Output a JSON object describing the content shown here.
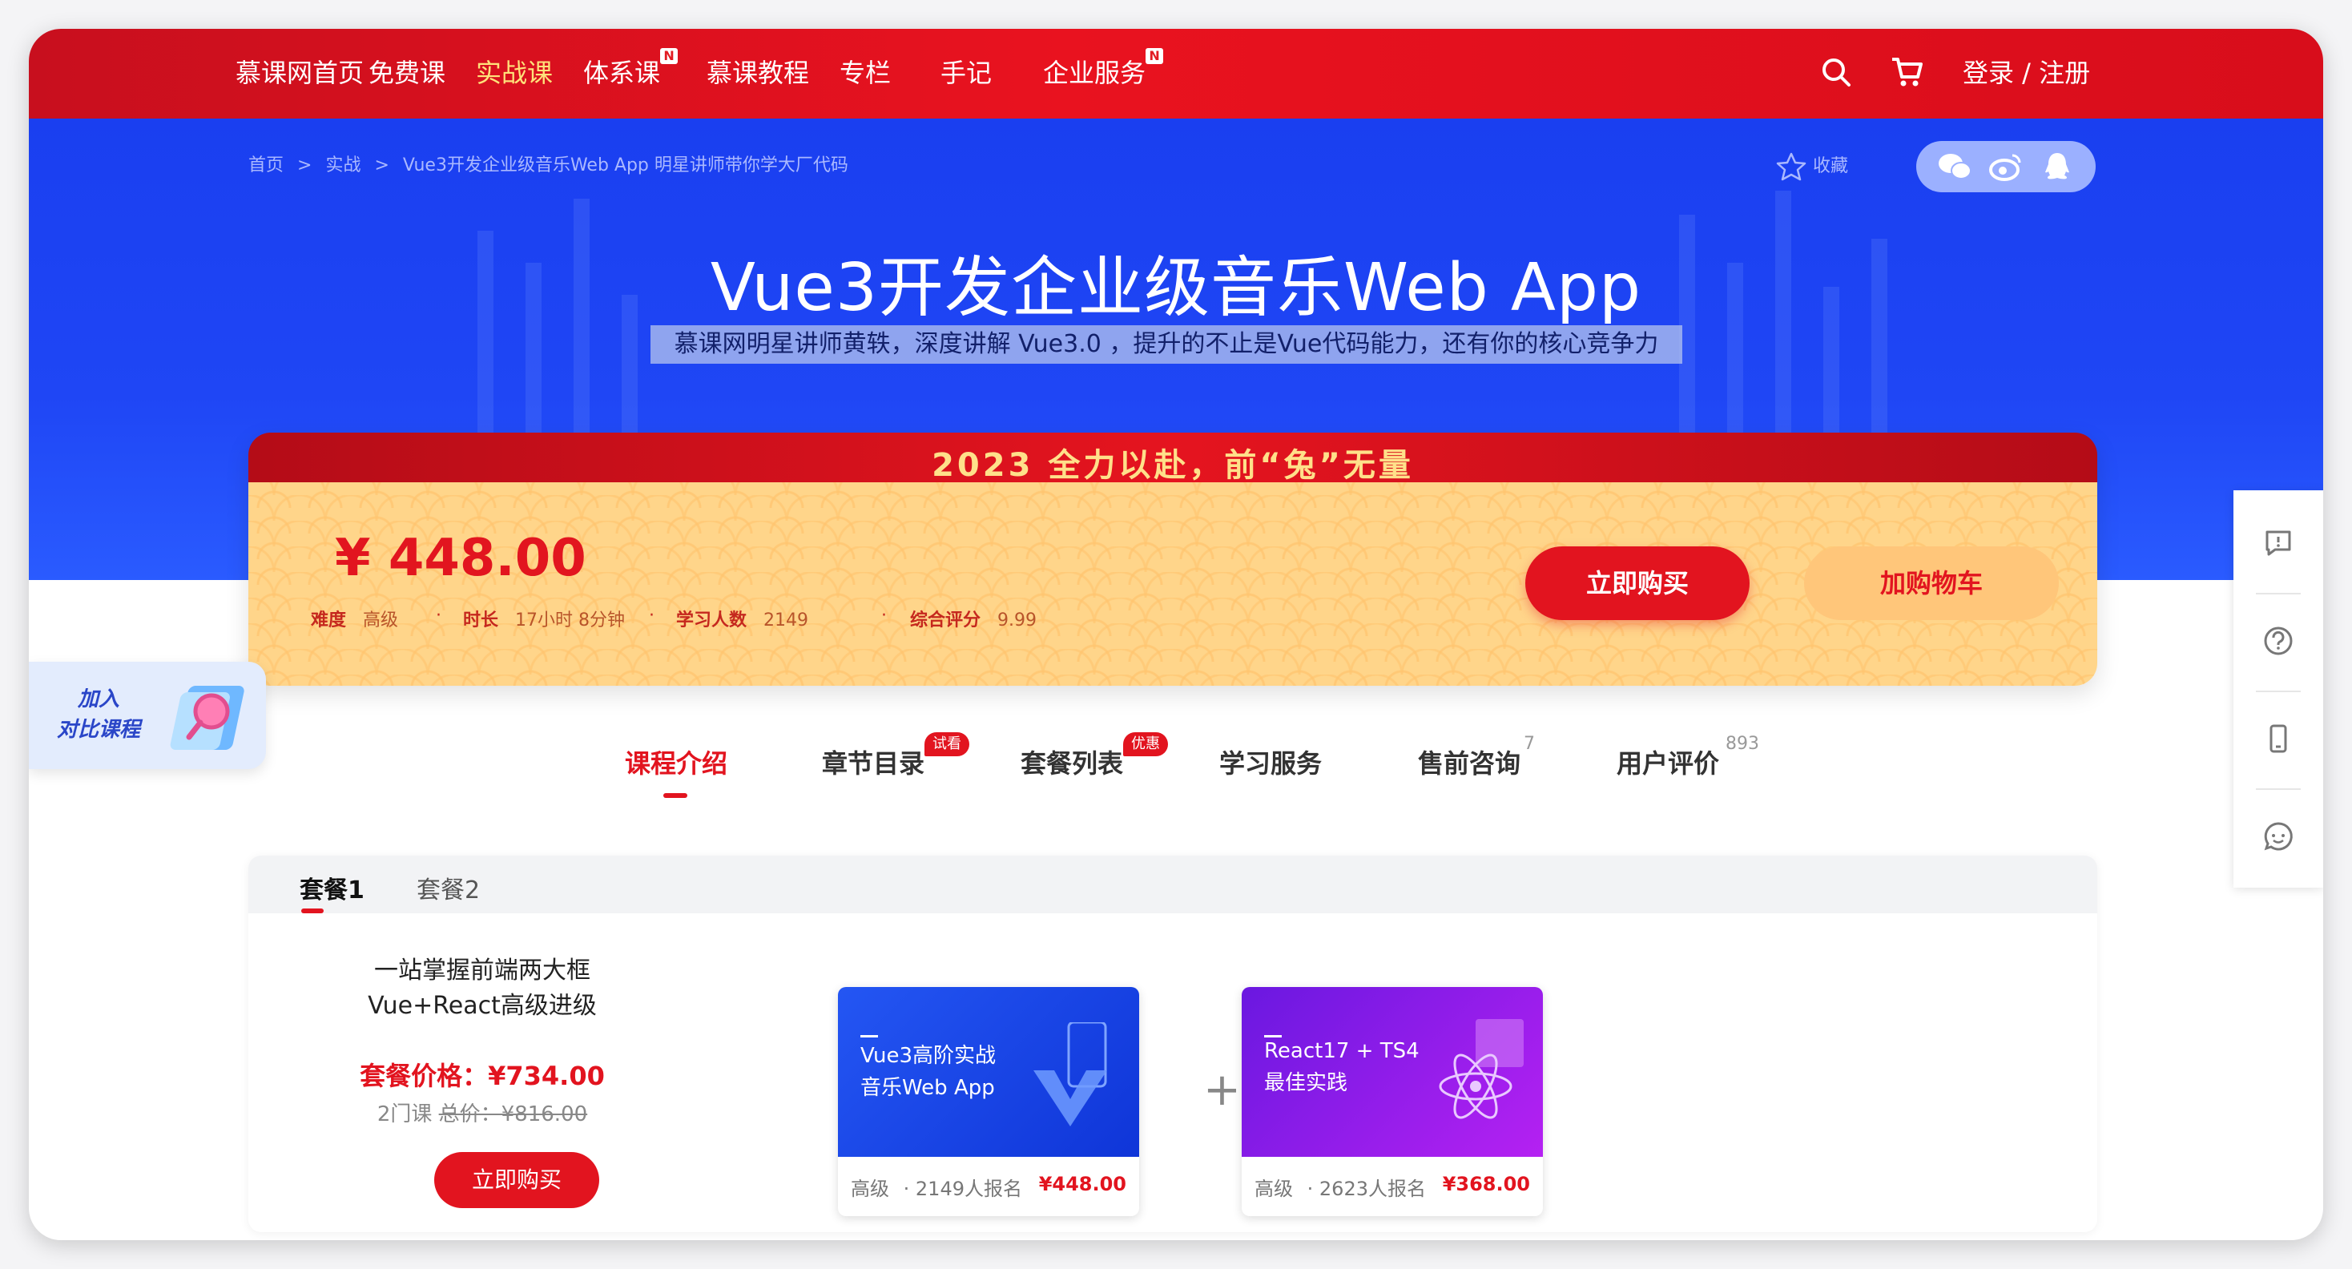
{
  "nav": {
    "items": [
      {
        "label": "慕课网首页",
        "active": false,
        "badge": ""
      },
      {
        "label": "免费课",
        "active": false,
        "badge": ""
      },
      {
        "label": "实战课",
        "active": true,
        "badge": ""
      },
      {
        "label": "体系课",
        "active": false,
        "badge": "N"
      },
      {
        "label": "慕课教程",
        "active": false,
        "badge": ""
      },
      {
        "label": "专栏",
        "active": false,
        "badge": ""
      },
      {
        "label": "手记",
        "active": false,
        "badge": ""
      },
      {
        "label": "企业服务",
        "active": false,
        "badge": "N"
      }
    ],
    "search_icon": "search-icon",
    "cart_icon": "cart-icon",
    "login_label": "登录 / 注册"
  },
  "breadcrumb": {
    "items": [
      "首页",
      "实战",
      "Vue3开发企业级音乐Web App 明星讲师带你学大厂代码"
    ],
    "separator": ">"
  },
  "collect_label": "收藏",
  "share_icons": [
    "wechat-icon",
    "weibo-icon",
    "qq-icon"
  ],
  "hero": {
    "title": "Vue3开发企业级音乐Web App",
    "subtitle": "慕课网明星讲师黄轶，深度讲解 Vue3.0 ，提升的不止是Vue代码能力，还有你的核心竞争力"
  },
  "promo_banner": "2023 全力以赴，前“兔”无量",
  "price": {
    "amount": "¥ 448.00",
    "meta": [
      {
        "key": "难度",
        "value": "高级"
      },
      {
        "key": "时长",
        "value": "17小时 8分钟"
      },
      {
        "key": "学习人数",
        "value": "2149"
      },
      {
        "key": "综合评分",
        "value": "9.99"
      }
    ],
    "buy_label": "立即购买",
    "cart_label": "加购物车"
  },
  "compare_label": "加入\n对比课程",
  "side_tools": [
    "feedback-icon",
    "help-icon",
    "mobile-icon",
    "chat-icon"
  ],
  "tabs": [
    {
      "label": "课程介绍",
      "active": true,
      "badge": "",
      "sup": ""
    },
    {
      "label": "章节目录",
      "active": false,
      "badge": "试看",
      "sup": ""
    },
    {
      "label": "套餐列表",
      "active": false,
      "badge": "优惠",
      "sup": ""
    },
    {
      "label": "学习服务",
      "active": false,
      "badge": "",
      "sup": ""
    },
    {
      "label": "售前咨询",
      "active": false,
      "badge": "",
      "sup": "7"
    },
    {
      "label": "用户评价",
      "active": false,
      "badge": "",
      "sup": "893"
    }
  ],
  "package": {
    "tabs": [
      {
        "label": "套餐1",
        "active": true
      },
      {
        "label": "套餐2",
        "active": false
      }
    ],
    "title": "一站掌握前端两大框 Vue+React高级进级",
    "price_label": "套餐价格：¥734.00",
    "course_count": "2门课",
    "total_label": "总价：¥816.00",
    "buy_label": "立即购买",
    "plus": "+",
    "courses": [
      {
        "cover_title": "Vue3高阶实战\n音乐Web App",
        "level": "高级",
        "enrolled": "· 2149人报名",
        "price": "¥448.00",
        "colors": [
          "#1d4ef0",
          "#0f35d8"
        ]
      },
      {
        "cover_title": "React17 + TS4\n最佳实践",
        "level": "高级",
        "enrolled": "· 2623人报名",
        "price": "¥368.00",
        "colors": [
          "#7a1ee6",
          "#b21df0"
        ]
      }
    ]
  },
  "colors": {
    "brand_red": "#e2141f",
    "hero_blue": "#1f46f5",
    "price_bg": "#ffd58a"
  }
}
